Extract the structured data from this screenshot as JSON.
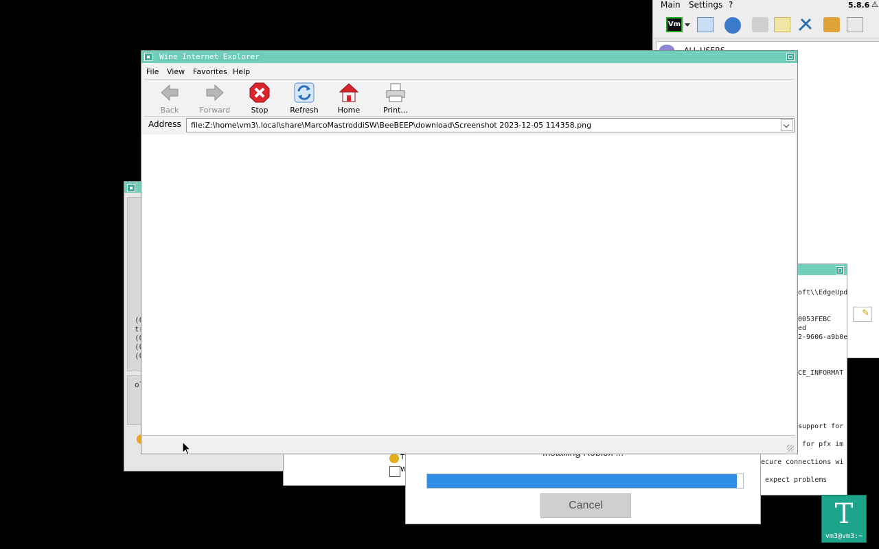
{
  "vmapp": {
    "menu": [
      "Main",
      "Settings",
      "?"
    ],
    "version": "5.8.6",
    "vm_logo": "Vm",
    "list_first_item": "ALL USERS"
  },
  "leftwin": {
    "log_lines": [
      "(0",
      "tr",
      "(0",
      "(0",
      "(0"
    ],
    "lower_text": "ol"
  },
  "termwin": {
    "lines": [
      "oft\\\\EdgeUpd",
      "0053FEBC",
      "ed",
      "2-9606-a9b0e",
      "CE_INFORMAT",
      "support for",
      "for pfx im",
      "ecure connections wi",
      "expect problems"
    ]
  },
  "smallwin": {
    "items": [
      "T",
      "W"
    ]
  },
  "install_dialog": {
    "title_text": "Installing Roblox ...",
    "progress_percent": 98,
    "cancel_label": "Cancel",
    "progress_color": "#2f8fe7"
  },
  "terminal_icon": {
    "glyph": "T",
    "label": "vm3@vm3:~"
  },
  "ie": {
    "title": "Wine Internet Explorer",
    "menu": {
      "file": "File",
      "view": "View",
      "favorites": "Favorites",
      "help": "Help"
    },
    "toolbar": {
      "back": "Back",
      "forward": "Forward",
      "stop": "Stop",
      "refresh": "Refresh",
      "home": "Home",
      "print": "Print..."
    },
    "address_label": "Address",
    "address_value": "file:Z:\\home\\vm3\\.local\\share\\MarcoMastroddiSW\\BeeBEEP\\download\\Screenshot 2023-12-05 114358.png",
    "accent_color": "#6dcdb8"
  }
}
